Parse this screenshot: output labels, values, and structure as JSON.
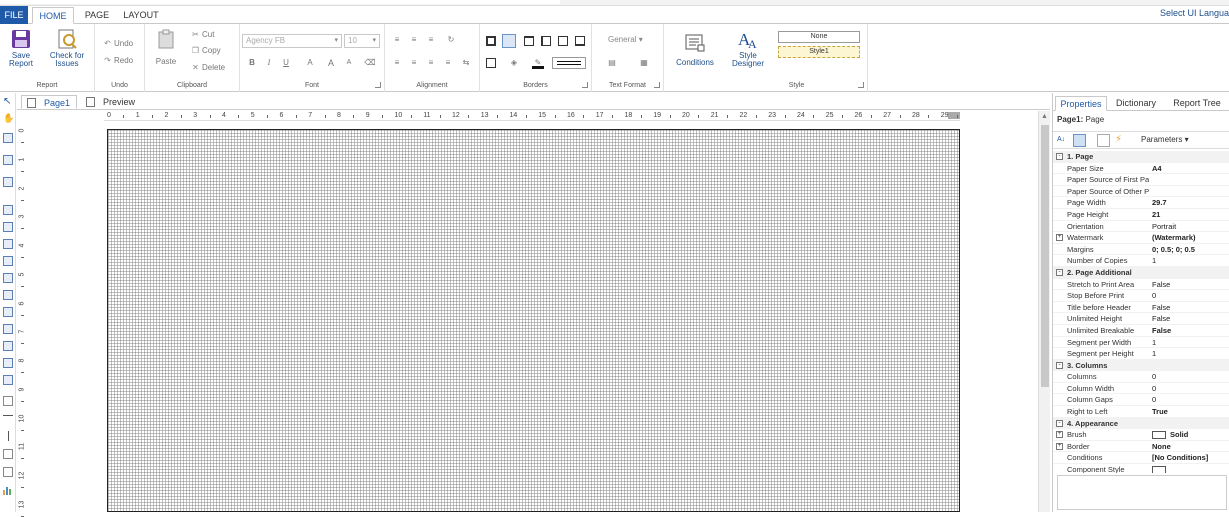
{
  "menu": {
    "file": "FILE",
    "tabs": [
      "HOME",
      "PAGE",
      "LAYOUT"
    ],
    "ui_language": "Select UI Langua"
  },
  "ribbon": {
    "report": {
      "label": "Report",
      "save_line1": "Save",
      "save_line2": "Report",
      "check_line1": "Check for",
      "check_line2": "Issues"
    },
    "undo": {
      "label": "Undo",
      "undo": "Undo",
      "redo": "Redo"
    },
    "clipboard": {
      "label": "Clipboard",
      "paste": "Paste",
      "cut": "Cut",
      "copy": "Copy",
      "delete": "Delete"
    },
    "font": {
      "label": "Font",
      "font_name": "Agency FB",
      "font_size": "10",
      "bold": "B",
      "italic": "I",
      "underline": "U",
      "font_color": "A",
      "grow": "A",
      "shrink": "A"
    },
    "alignment": {
      "label": "Alignment"
    },
    "borders": {
      "label": "Borders"
    },
    "text_format": {
      "label": "Text Format",
      "format": "General"
    },
    "conditions": {
      "label": "Conditions"
    },
    "style": {
      "label": "Style",
      "designer_line1": "Style",
      "designer_line2": "Designer",
      "none": "None",
      "style1": "Style1"
    }
  },
  "doc_tabs": {
    "page1": "Page1",
    "preview": "Preview"
  },
  "ruler": {
    "h": [
      "0",
      "1",
      "2",
      "3",
      "4",
      "5",
      "6",
      "7",
      "8",
      "9",
      "10",
      "11",
      "12",
      "13",
      "14",
      "15",
      "16",
      "17",
      "18",
      "19",
      "20",
      "21",
      "22",
      "23",
      "24",
      "25",
      "26",
      "27",
      "28",
      "29"
    ],
    "v": [
      "0",
      "1",
      "2",
      "3",
      "4",
      "5",
      "6",
      "7",
      "8",
      "9",
      "10",
      "11",
      "12",
      "13"
    ]
  },
  "panel": {
    "tabs": [
      "Properties",
      "Dictionary",
      "Report Tree"
    ],
    "title_bold": "Page1:",
    "title_rest": " Page",
    "parameters": "Parameters",
    "rows": [
      {
        "cat": true,
        "exp": "⊟",
        "k": "1. Page"
      },
      {
        "k": "Paper Size",
        "v": "A4",
        "b": true
      },
      {
        "k": "Paper Source of First Page",
        "v": ""
      },
      {
        "k": "Paper Source of Other Pages",
        "v": ""
      },
      {
        "k": "Page Width",
        "v": "29.7",
        "b": true
      },
      {
        "k": "Page Height",
        "v": "21",
        "b": true
      },
      {
        "k": "Orientation",
        "v": "Portrait"
      },
      {
        "k": "Watermark",
        "v": "(Watermark)",
        "b": true,
        "exp": "+"
      },
      {
        "k": "Margins",
        "v": "0; 0.5; 0; 0.5",
        "b": true
      },
      {
        "k": "Number of Copies",
        "v": "1"
      },
      {
        "cat": true,
        "exp": "⊟",
        "k": "2. Page Additional"
      },
      {
        "k": "Stretch to Print Area",
        "v": "False"
      },
      {
        "k": "Stop Before Print",
        "v": "0"
      },
      {
        "k": "Title before Header",
        "v": "False"
      },
      {
        "k": "Unlimited Height",
        "v": "False"
      },
      {
        "k": "Unlimited Breakable",
        "v": "False",
        "b": true
      },
      {
        "k": "Segment per Width",
        "v": "1"
      },
      {
        "k": "Segment per Height",
        "v": "1"
      },
      {
        "cat": true,
        "exp": "⊟",
        "k": "3. Columns"
      },
      {
        "k": "Columns",
        "v": "0"
      },
      {
        "k": "Column Width",
        "v": "0"
      },
      {
        "k": "Column Gaps",
        "v": "0"
      },
      {
        "k": "Right to Left",
        "v": "True",
        "b": true
      },
      {
        "cat": true,
        "exp": "⊟",
        "k": "4. Appearance"
      },
      {
        "k": "Brush",
        "v": "Solid",
        "b": true,
        "exp": "+",
        "swatch": true
      },
      {
        "k": "Border",
        "v": "None",
        "b": true,
        "exp": "+"
      },
      {
        "k": "Conditions",
        "v": "[No Conditions]",
        "b": true
      },
      {
        "k": "Component Style",
        "v": "",
        "swatch": true
      }
    ]
  },
  "colors": {
    "accent": "#1e5aa8",
    "file_bg": "#1e5aa8",
    "style1_bg": "#fdf6d2"
  }
}
